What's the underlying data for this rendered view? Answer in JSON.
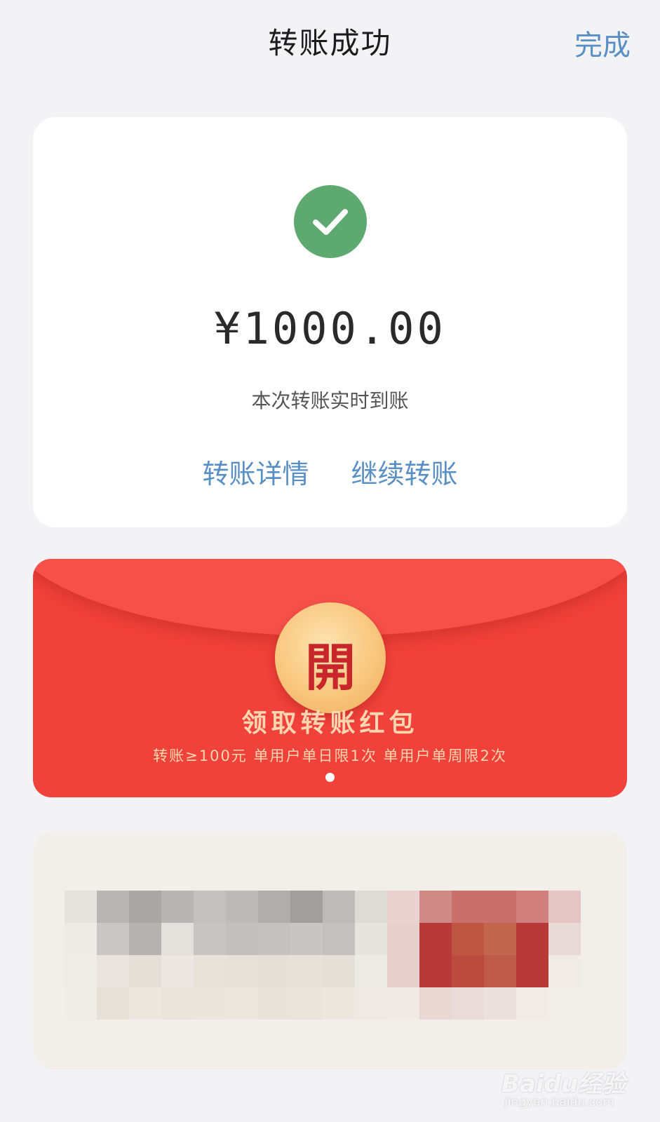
{
  "header": {
    "title": "转账成功",
    "done_label": "完成"
  },
  "result_card": {
    "status_icon": "check-circle-icon",
    "status_color": "#5da96f",
    "amount": "¥1000.00",
    "note": "本次转账实时到账",
    "actions": {
      "details_label": "转账详情",
      "continue_label": "继续转账"
    },
    "link_color": "#5a8fc4"
  },
  "red_packet": {
    "coin_char": "開",
    "title": "领取转账红包",
    "rules": "转账≥100元 单用户单日限1次 单用户单周限2次",
    "background_color": "#f0413a",
    "carousel": {
      "page_count": 1,
      "current_index": 0
    }
  },
  "ad_banner": {
    "content": "",
    "obscured": true
  },
  "watermark": {
    "brand": "Baidu经验",
    "url": "jingyan.baidu.com"
  }
}
